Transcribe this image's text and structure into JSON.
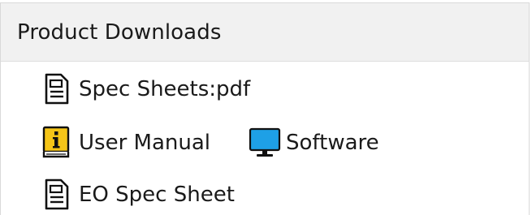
{
  "header": {
    "title": "Product Downloads"
  },
  "downloads": {
    "spec_sheets": {
      "label": "Spec Sheets:pdf",
      "icon": "document-icon"
    },
    "user_manual": {
      "label": "User Manual",
      "icon": "manual-info-icon",
      "icon_color": "#f5c518"
    },
    "software": {
      "label": "Software",
      "icon": "monitor-icon",
      "icon_color": "#1ea0e6"
    },
    "eo_spec_sheet": {
      "label": "EO Spec Sheet",
      "icon": "document-icon"
    }
  }
}
